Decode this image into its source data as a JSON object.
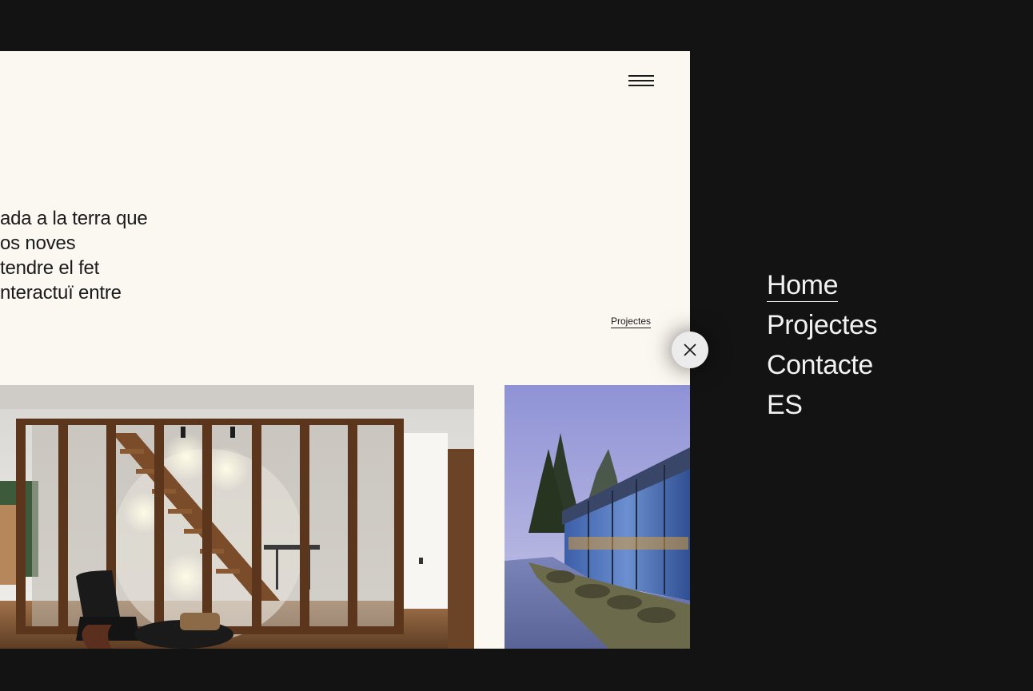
{
  "header": {
    "menu_icon": "hamburger-menu-icon"
  },
  "intro": {
    "lines": [
      "ada a la terra que",
      "os noves",
      "tendre el fet",
      "nteractuï entre"
    ]
  },
  "projects_link": {
    "label": "Projectes"
  },
  "images": [
    {
      "subject": "interior staircase with wooden frames and leather lounge chair"
    },
    {
      "subject": "modern glass house exterior at dusk"
    }
  ],
  "close_button": {
    "icon": "close-icon"
  },
  "nav_menu": {
    "items": [
      {
        "label": "Home",
        "active": true
      },
      {
        "label": "Projectes",
        "active": false
      },
      {
        "label": "Contacte",
        "active": false
      },
      {
        "label": "ES",
        "active": false
      }
    ]
  },
  "colors": {
    "background": "#131313",
    "page_panel": "#fbf7f1",
    "text_dark": "#1b1b1b",
    "menu_text": "#f1f1f1",
    "close_button_bg": "#ececec"
  }
}
